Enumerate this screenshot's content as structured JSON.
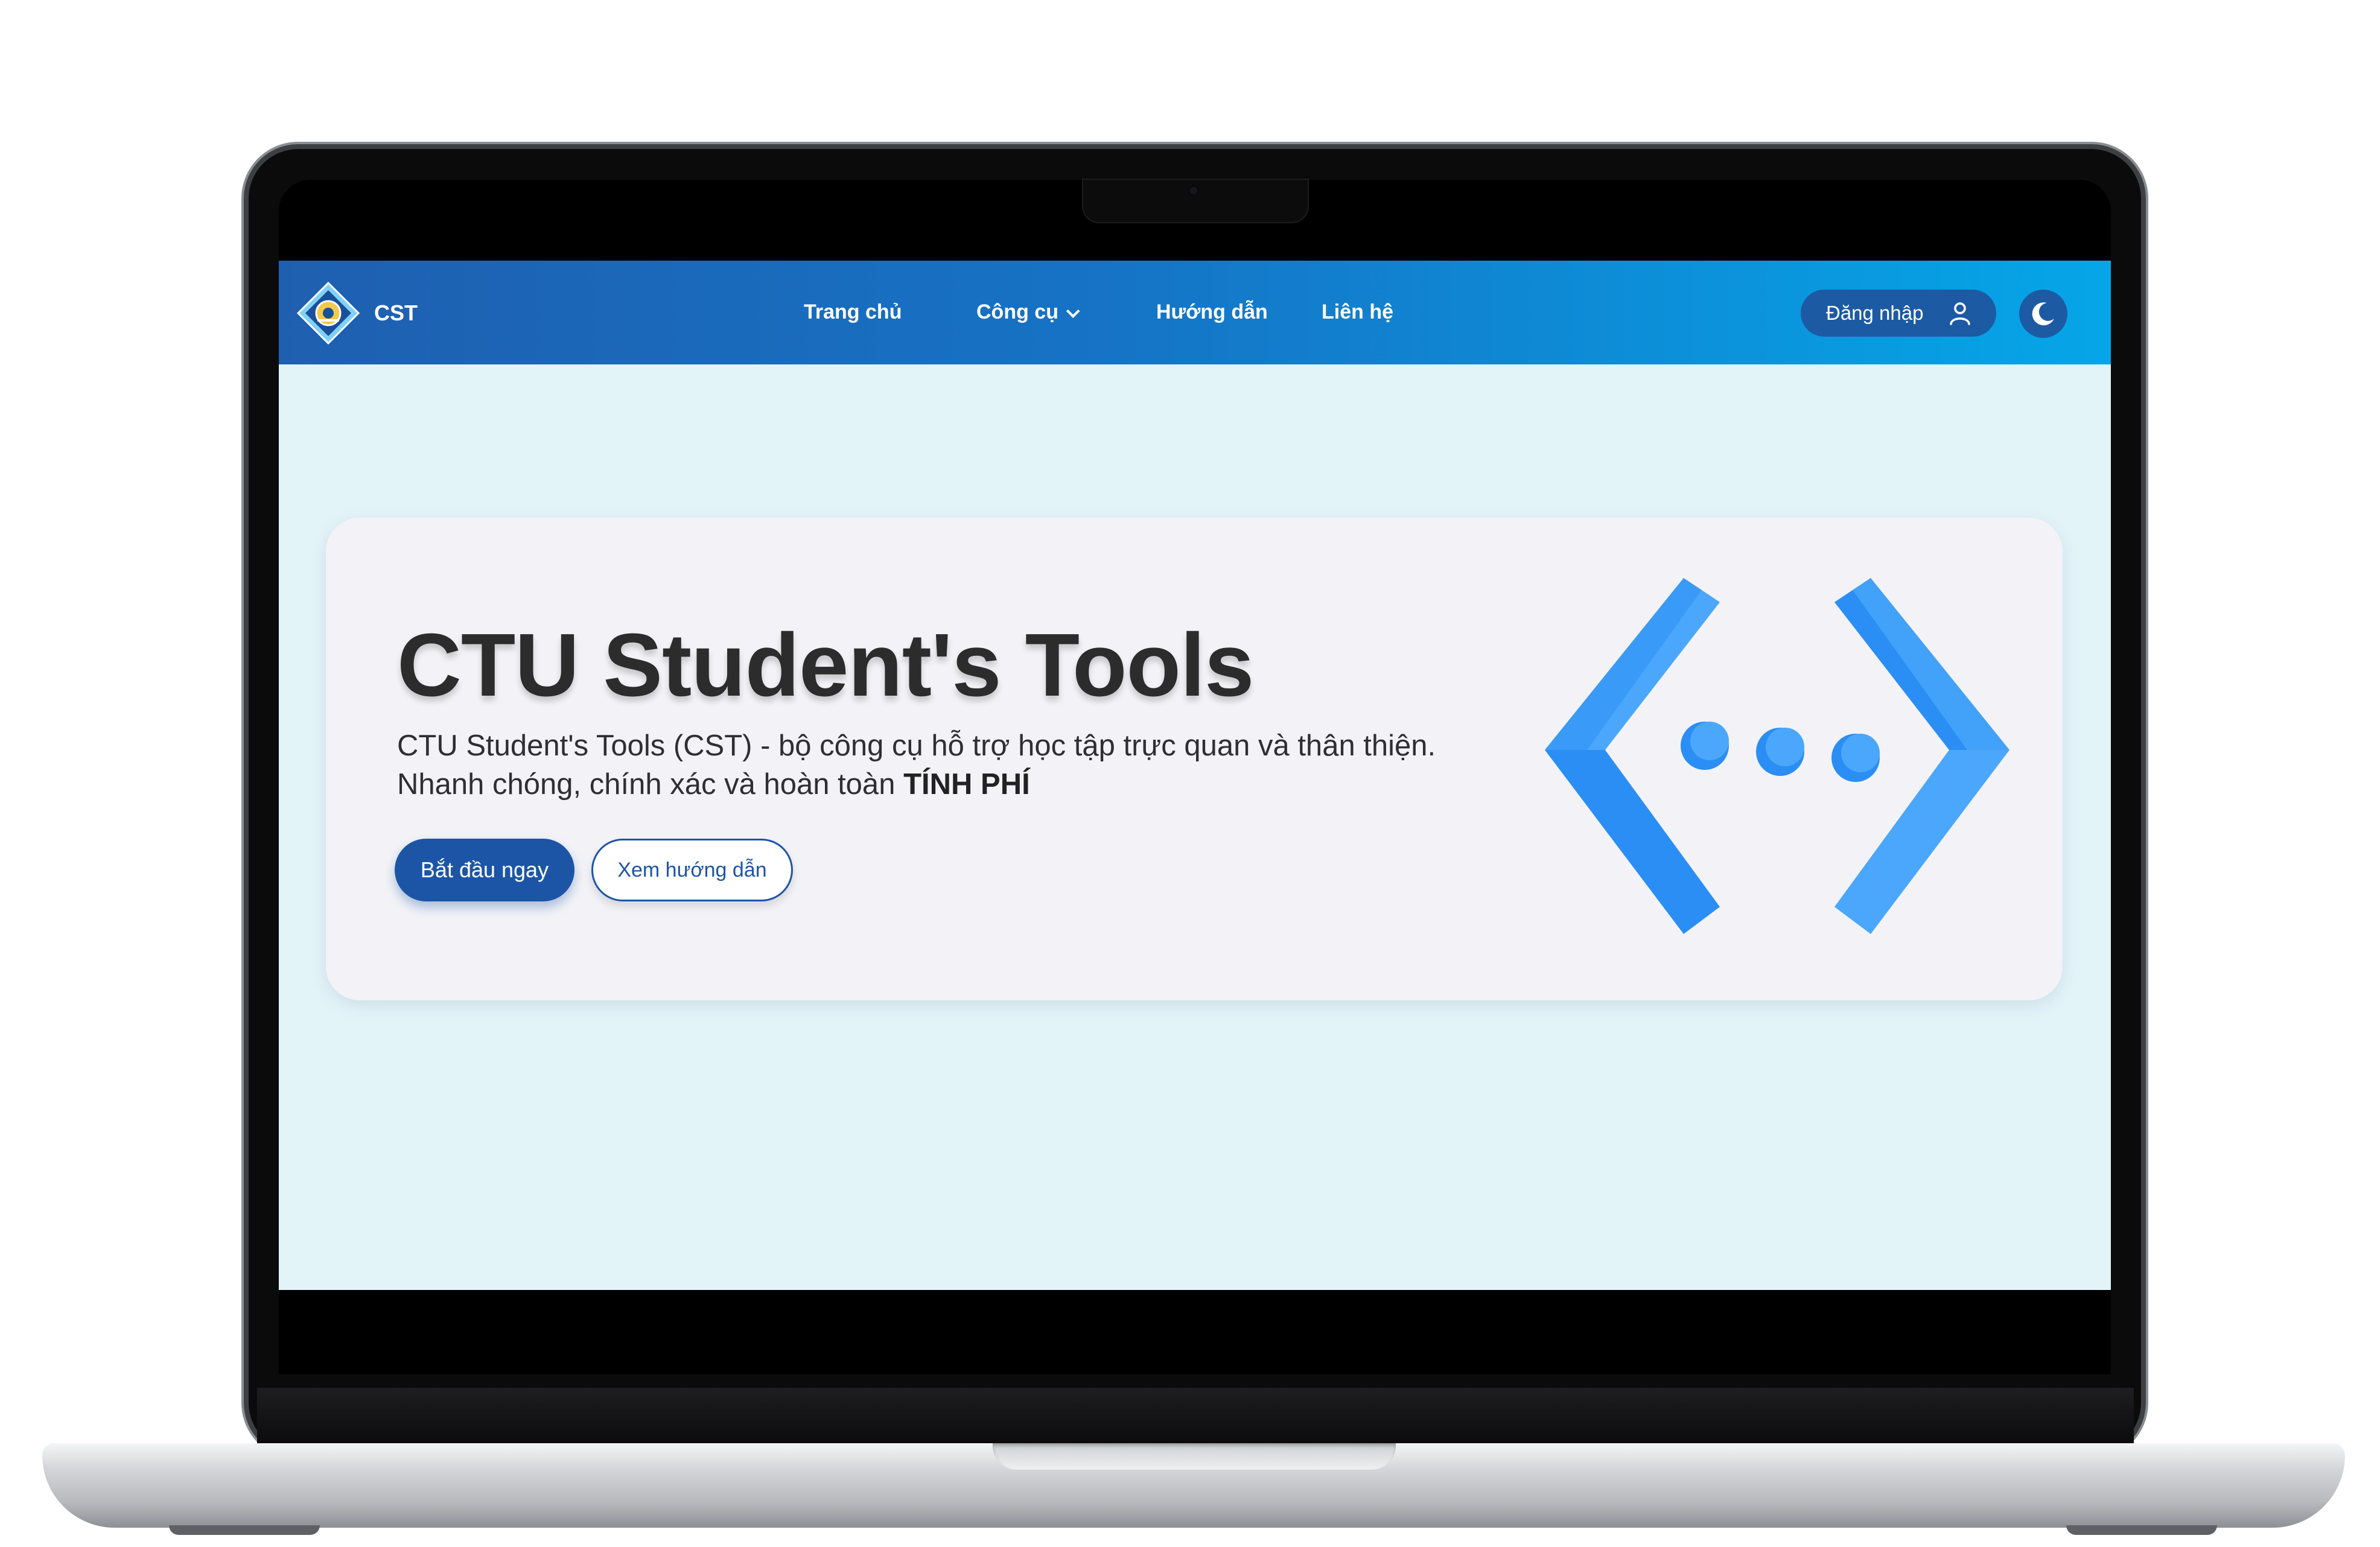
{
  "navbar": {
    "brand": "CST",
    "links": {
      "home": "Trang chủ",
      "tools": "Công cụ",
      "guide": "Hướng dẫn",
      "contact": "Liên hệ"
    },
    "login_label": "Đăng nhập"
  },
  "hero": {
    "title": "CTU Student's Tools",
    "description": "CTU Student's Tools (CST) - bộ công cụ hỗ trợ học tập trực quan và thân thiện. Nhanh chóng, chính xác và hoàn toàn",
    "description_emphasis": "TÍNH PHÍ",
    "start_button": "Bắt đầu ngay",
    "guide_button": "Xem hướng dẫn"
  },
  "icons": {
    "logo": "cst-logo-icon",
    "user": "user-icon",
    "theme": "moon-icon",
    "hero": "code-brackets-icon"
  },
  "colors": {
    "navbar_start": "#1f5fb0",
    "navbar_end": "#05a6e8",
    "primary_button": "#1d55a6",
    "page_background": "#e3f4f9",
    "card_background": "#f3f3f7",
    "icon_blue_light": "#4aa7fb",
    "icon_blue_dark": "#2b8ef4"
  }
}
